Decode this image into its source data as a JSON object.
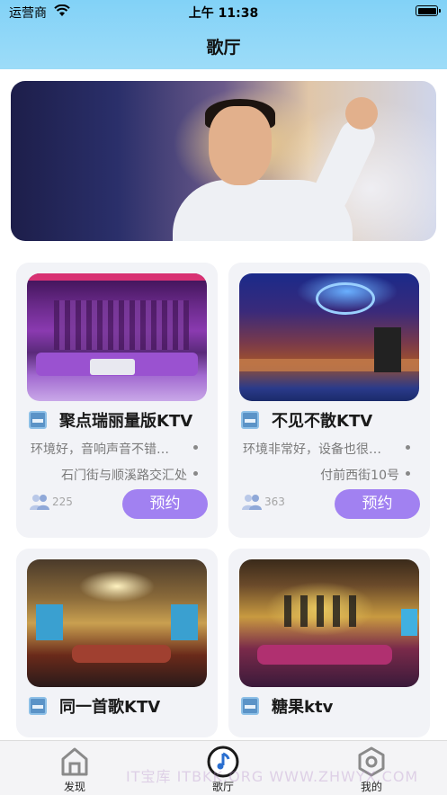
{
  "status_bar": {
    "carrier": "运营商",
    "time": "上午 11:38"
  },
  "header": {
    "title": "歌厅"
  },
  "banner": {
    "image": "singer-performance-photo"
  },
  "venues": [
    {
      "name": "聚点瑞丽量版KTV",
      "description": "环境好，音响声音不错…",
      "address": "石门街与顺溪路交汇处",
      "count": "225",
      "book_label": "预约"
    },
    {
      "name": "不见不散KTV",
      "description": "环境非常好，设备也很…",
      "address": "付前西街10号",
      "count": "363",
      "book_label": "预约"
    },
    {
      "name": "同一首歌KTV"
    },
    {
      "name": "糖果ktv"
    }
  ],
  "tabbar": {
    "items": [
      {
        "label": "发现",
        "icon": "home-icon"
      },
      {
        "label": "歌厅",
        "icon": "music-note-icon",
        "active": true
      },
      {
        "label": "我的",
        "icon": "hexagon-profile-icon"
      }
    ]
  },
  "watermark": "IT宝库 ITBKK.ORG WWW.ZHWYX.COM",
  "colors": {
    "header": "#9ddcf8",
    "accent": "#a181f1",
    "card_bg": "#f2f3f7"
  }
}
